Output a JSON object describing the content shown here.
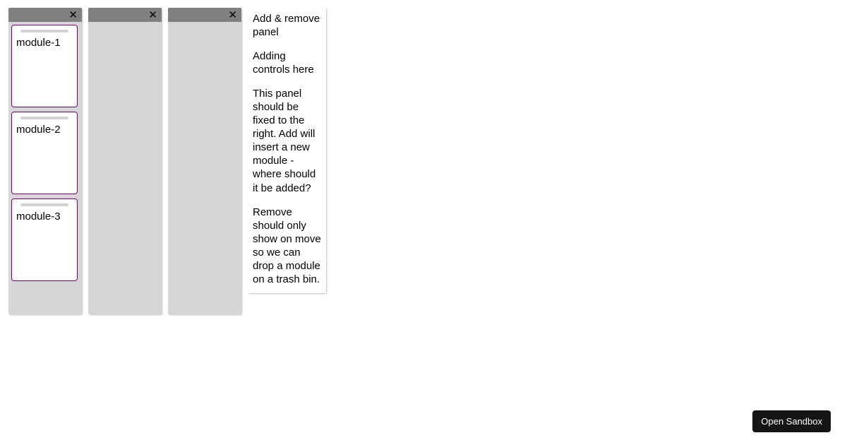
{
  "columns": [
    {
      "close": "✕",
      "modules": [
        {
          "label": "module-1"
        },
        {
          "label": "module-2"
        },
        {
          "label": "module-3"
        }
      ]
    },
    {
      "close": "✕",
      "modules": []
    },
    {
      "close": "✕",
      "modules": []
    }
  ],
  "info": {
    "p1": "Add & remove panel",
    "p2": "Adding controls here",
    "p3": "This panel should be fixed to the right. Add will insert a new module - where should it be added?",
    "p4": "Remove should only show on move so we can drop a module on a trash bin."
  },
  "sandbox": {
    "label": "Open Sandbox"
  }
}
